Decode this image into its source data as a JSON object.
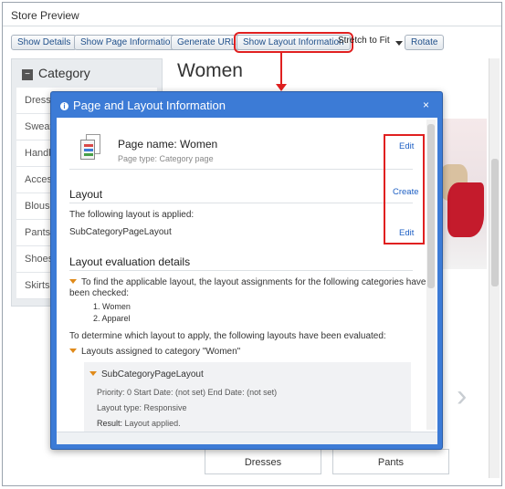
{
  "window": {
    "title": "Store Preview"
  },
  "toolbar": {
    "show_details": "Show Details",
    "show_page_info": "Show Page Information",
    "generate_url": "Generate URL",
    "show_layout_info": "Show Layout Information",
    "stretch_select": "Stretch to Fit",
    "rotate": "Rotate"
  },
  "background": {
    "category_header": "Category",
    "categories": [
      "Dress",
      "Sweat",
      "Handb",
      "Acces",
      "Blous",
      "Pants",
      "Shoes",
      "Skirts"
    ],
    "page_title": "Women",
    "bottom_buttons": [
      "Dresses",
      "Pants"
    ]
  },
  "dialog": {
    "title": "Page and Layout Information",
    "close": "×",
    "page_name": "Page name: Women",
    "page_type": "Page type: Category page",
    "edit_label": "Edit",
    "layout_heading": "Layout",
    "create_label": "Create",
    "layout_applied_text": "The following layout is applied:",
    "layout_name": "SubCategoryPageLayout",
    "eval_heading": "Layout evaluation details",
    "eval_intro_1": "To find the applicable layout, the layout assignments for the following categories have",
    "eval_intro_2": "been checked:",
    "checked_categories": [
      "1.   Women",
      "2.   Apparel"
    ],
    "determine_text": "To determine which layout to apply, the following layouts have been evaluated:",
    "assigned_text": "Layouts assigned to category \"Women\"",
    "sub_layout": {
      "name": "SubCategoryPageLayout",
      "priority_line": "Priority:  0  Start Date:  (not set)  End Date:  (not set)",
      "type_line": "Layout type: Responsive",
      "result_label": "Result:",
      "result_value": "Layout applied."
    }
  },
  "colors": {
    "dialog_header": "#3c7bd6",
    "highlight": "#e02020",
    "link": "#1d5fc4"
  }
}
